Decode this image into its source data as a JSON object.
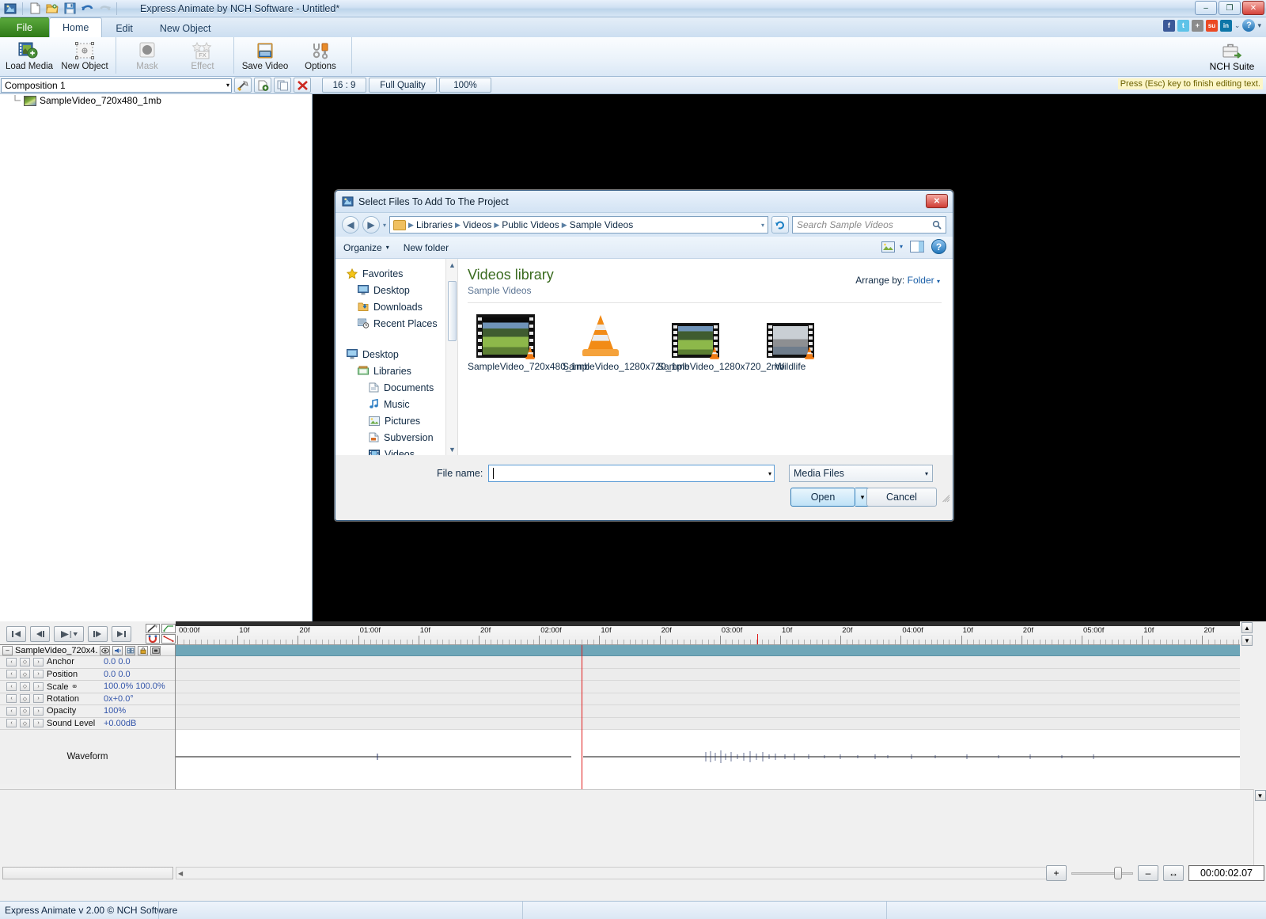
{
  "window": {
    "title": "Express Animate by NCH Software - Untitled*",
    "minimize": "–",
    "restore": "❐",
    "close": "✕",
    "quick_access": [
      "app-icon",
      "new-icon",
      "open-icon",
      "save-icon",
      "undo-icon",
      "redo-icon"
    ]
  },
  "tabs": [
    {
      "label": "File",
      "active": false,
      "kind": "file"
    },
    {
      "label": "Home",
      "active": true,
      "kind": "normal"
    },
    {
      "label": "Edit",
      "active": false,
      "kind": "normal"
    },
    {
      "label": "New Object",
      "active": false,
      "kind": "normal"
    }
  ],
  "social": [
    {
      "name": "facebook-icon",
      "glyph": "f",
      "color": "#3b5998"
    },
    {
      "name": "twitter-icon",
      "glyph": "t",
      "color": "#5ec3e8"
    },
    {
      "name": "share-icon",
      "glyph": "+",
      "color": "#8b8b8b"
    },
    {
      "name": "stumbleupon-icon",
      "glyph": "su",
      "color": "#eb4924"
    },
    {
      "name": "linkedin-icon",
      "glyph": "in",
      "color": "#0e76a8"
    }
  ],
  "social_caret": "⌄",
  "help_glyph": "?",
  "help_caret": "▾",
  "ribbon": {
    "buttons": [
      {
        "label": "Load Media",
        "disabled": false,
        "icon": "load-media-icon"
      },
      {
        "label": "New Object",
        "disabled": false,
        "icon": "new-object-icon"
      },
      {
        "label": "Mask",
        "disabled": true,
        "icon": "mask-icon"
      },
      {
        "label": "Effect",
        "disabled": true,
        "icon": "effect-icon"
      },
      {
        "label": "Save Video",
        "disabled": false,
        "icon": "save-video-icon"
      },
      {
        "label": "Options",
        "disabled": false,
        "icon": "options-icon"
      }
    ],
    "suite_label": "NCH Suite"
  },
  "compbar": {
    "composition": "Composition 1",
    "dropdown_caret": "▾",
    "tool_buttons": [
      "composition-settings-icon",
      "add-composition-icon",
      "duplicate-composition-icon",
      "delete-composition-icon"
    ],
    "aspect_ratio": "16 : 9",
    "quality": "Full Quality",
    "zoom": "100%",
    "esc_hint": "Press (Esc) key to finish editing text."
  },
  "object_tree": {
    "items": [
      {
        "label": "SampleVideo_720x480_1mb"
      }
    ]
  },
  "dialog": {
    "title": "Select Files To Add To The Project",
    "close": "✕",
    "nav": {
      "back": "◀",
      "forward": "▶",
      "history_caret": "▾",
      "breadcrumbs": [
        "Libraries",
        "Videos",
        "Public Videos",
        "Sample Videos"
      ],
      "crumb_sep": "▶",
      "crumb_caret": "▾",
      "refresh": "↻",
      "search_placeholder": "Search Sample Videos",
      "search_icon": "🔍"
    },
    "toolbar": {
      "organize": "Organize",
      "organize_caret": "▾",
      "new_folder": "New folder",
      "view_caret": "▾",
      "help": "?"
    },
    "nav_pane": [
      {
        "label": "Favorites",
        "icon": "star-icon",
        "indent": 0
      },
      {
        "label": "Desktop",
        "icon": "desktop-icon",
        "indent": 1
      },
      {
        "label": "Downloads",
        "icon": "downloads-icon",
        "indent": 1
      },
      {
        "label": "Recent Places",
        "icon": "recent-places-icon",
        "indent": 1
      },
      {
        "label": "",
        "icon": "",
        "indent": 0
      },
      {
        "label": "Desktop",
        "icon": "desktop-icon",
        "indent": 0
      },
      {
        "label": "Libraries",
        "icon": "libraries-icon",
        "indent": 1
      },
      {
        "label": "Documents",
        "icon": "documents-icon",
        "indent": 2
      },
      {
        "label": "Music",
        "icon": "music-icon",
        "indent": 2
      },
      {
        "label": "Pictures",
        "icon": "pictures-icon",
        "indent": 2
      },
      {
        "label": "Subversion",
        "icon": "subversion-icon",
        "indent": 2
      },
      {
        "label": "Videos",
        "icon": "videos-icon",
        "indent": 2
      }
    ],
    "library": {
      "title": "Videos library",
      "subtitle": "Sample Videos",
      "arrange_by_label": "Arrange by:",
      "arrange_by_value": "Folder",
      "arrange_caret": "▾"
    },
    "files": [
      {
        "name": "SampleVideo_720x480_1mb",
        "kind": "filmstrip-badger"
      },
      {
        "name": "SampleVideo_1280x720_1mb",
        "kind": "vlc-cone"
      },
      {
        "name": "SampleVideo_1280x720_2mb",
        "kind": "filmstrip-badger"
      },
      {
        "name": "Wildlife",
        "kind": "filmstrip-wildlife"
      }
    ],
    "footer": {
      "file_name_label": "File name:",
      "file_name_value": "",
      "file_name_caret": "▾",
      "file_type": "Media Files",
      "file_type_caret": "▾",
      "open": "Open",
      "open_caret": "▾",
      "cancel": "Cancel"
    }
  },
  "timeline": {
    "transport": [
      {
        "name": "go-to-start-button",
        "glyph": "|◀"
      },
      {
        "name": "step-back-button",
        "glyph": "◀|"
      },
      {
        "name": "play-button",
        "glyph": "▶"
      },
      {
        "name": "play-dropdown",
        "glyph": "▾"
      },
      {
        "name": "step-forward-button",
        "glyph": "|▶"
      },
      {
        "name": "go-to-end-button",
        "glyph": "▶|"
      }
    ],
    "tool_icons": [
      "draw-mask-icon",
      "keyframe-path-icon",
      "snap-magnet-icon",
      "motion-path-icon"
    ],
    "ruler_labels": [
      "00:00f",
      "10f",
      "20f",
      "01:00f",
      "10f",
      "20f",
      "02:00f",
      "10f",
      "20f",
      "03:00f",
      "10f",
      "20f",
      "04:00f",
      "10f",
      "20f",
      "05:00f",
      "10f",
      "20f"
    ],
    "layer": {
      "collapse": "–",
      "name": "SampleVideo_720x4...",
      "icons": [
        "visibility-icon",
        "audio-icon",
        "solo-icon",
        "lock-icon",
        "shy-icon"
      ]
    },
    "properties": [
      {
        "name": "Anchor",
        "value": "0.0  0.0"
      },
      {
        "name": "Position",
        "value": "0.0  0.0"
      },
      {
        "name": "Scale",
        "value": "100.0%  100.0%",
        "link_icon": true
      },
      {
        "name": "Rotation",
        "value": "0x+0.0°"
      },
      {
        "name": "Opacity",
        "value": "100%"
      },
      {
        "name": "Sound Level",
        "value": "+0.00dB"
      }
    ],
    "waveform_label": "Waveform",
    "keyframe_prev": "‹",
    "keyframe_mark": "◇",
    "keyframe_next": "›"
  },
  "bottom": {
    "zoom_out": "–",
    "zoom_in": "+",
    "fit": "↔",
    "timecode": "00:00:02.07",
    "scroll_left_arrow": "◀",
    "scroll_right_arrow": "▶"
  },
  "status": {
    "text": "Express Animate v 2.00 © NCH Software"
  },
  "colors": {
    "accent": "#2f7a18",
    "track": "#6fa6b8",
    "playhead": "#e01b1b",
    "value_text": "#3355aa",
    "hint_bg": "#fcf6c8"
  }
}
